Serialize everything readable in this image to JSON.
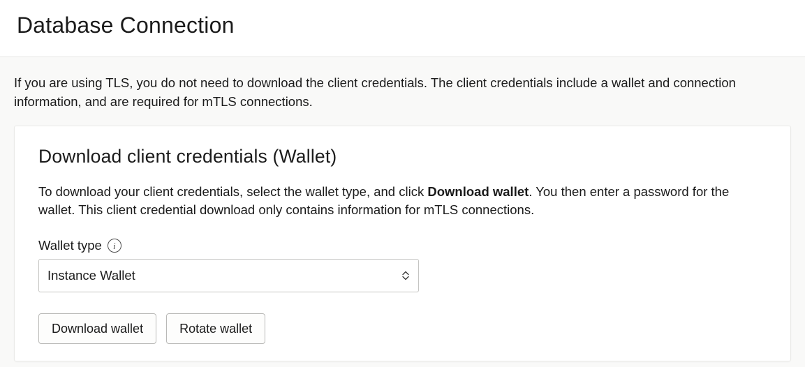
{
  "header": {
    "title": "Database Connection"
  },
  "intro": {
    "text": "If you are using TLS, you do not need to download the client credentials. The client credentials include a wallet and connection information, and are required for mTLS connections."
  },
  "card": {
    "title": "Download client credentials (Wallet)",
    "desc_prefix": "To download your client credentials, select the wallet type, and click ",
    "desc_bold": "Download wallet",
    "desc_suffix": ". You then enter a password for the wallet. This client credential download only contains information for mTLS connections.",
    "wallet_type_label": "Wallet type",
    "wallet_type_value": "Instance Wallet",
    "download_button": "Download wallet",
    "rotate_button": "Rotate wallet"
  }
}
